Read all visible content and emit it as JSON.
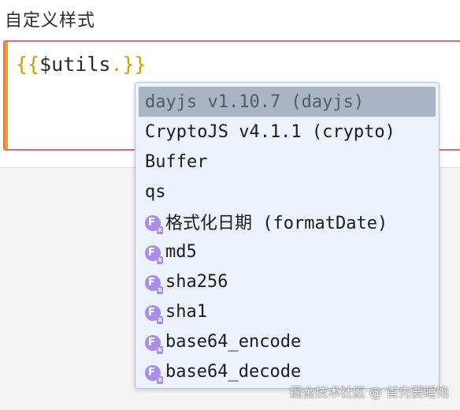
{
  "section": {
    "title": "自定义样式"
  },
  "editor": {
    "brace_open": "{{",
    "var": "$utils",
    "dot": ".",
    "brace_close": "}}"
  },
  "suggestions": [
    {
      "label": "dayjs v1.10.7 (dayjs)",
      "icon": null,
      "selected": true
    },
    {
      "label": "CryptoJS v4.1.1 (crypto)",
      "icon": null
    },
    {
      "label": "Buffer",
      "icon": null
    },
    {
      "label": "qs",
      "icon": null
    },
    {
      "label": "格式化日期 (formatDate)",
      "icon": "function-icon"
    },
    {
      "label": "md5",
      "icon": "function-icon"
    },
    {
      "label": "sha256",
      "icon": "function-icon"
    },
    {
      "label": "sha1",
      "icon": "function-icon"
    },
    {
      "label": "base64_encode",
      "icon": "function-icon"
    },
    {
      "label": "base64_decode",
      "icon": "function-icon"
    }
  ],
  "watermark": "掘金技术社区 @ 首先要睡饱"
}
